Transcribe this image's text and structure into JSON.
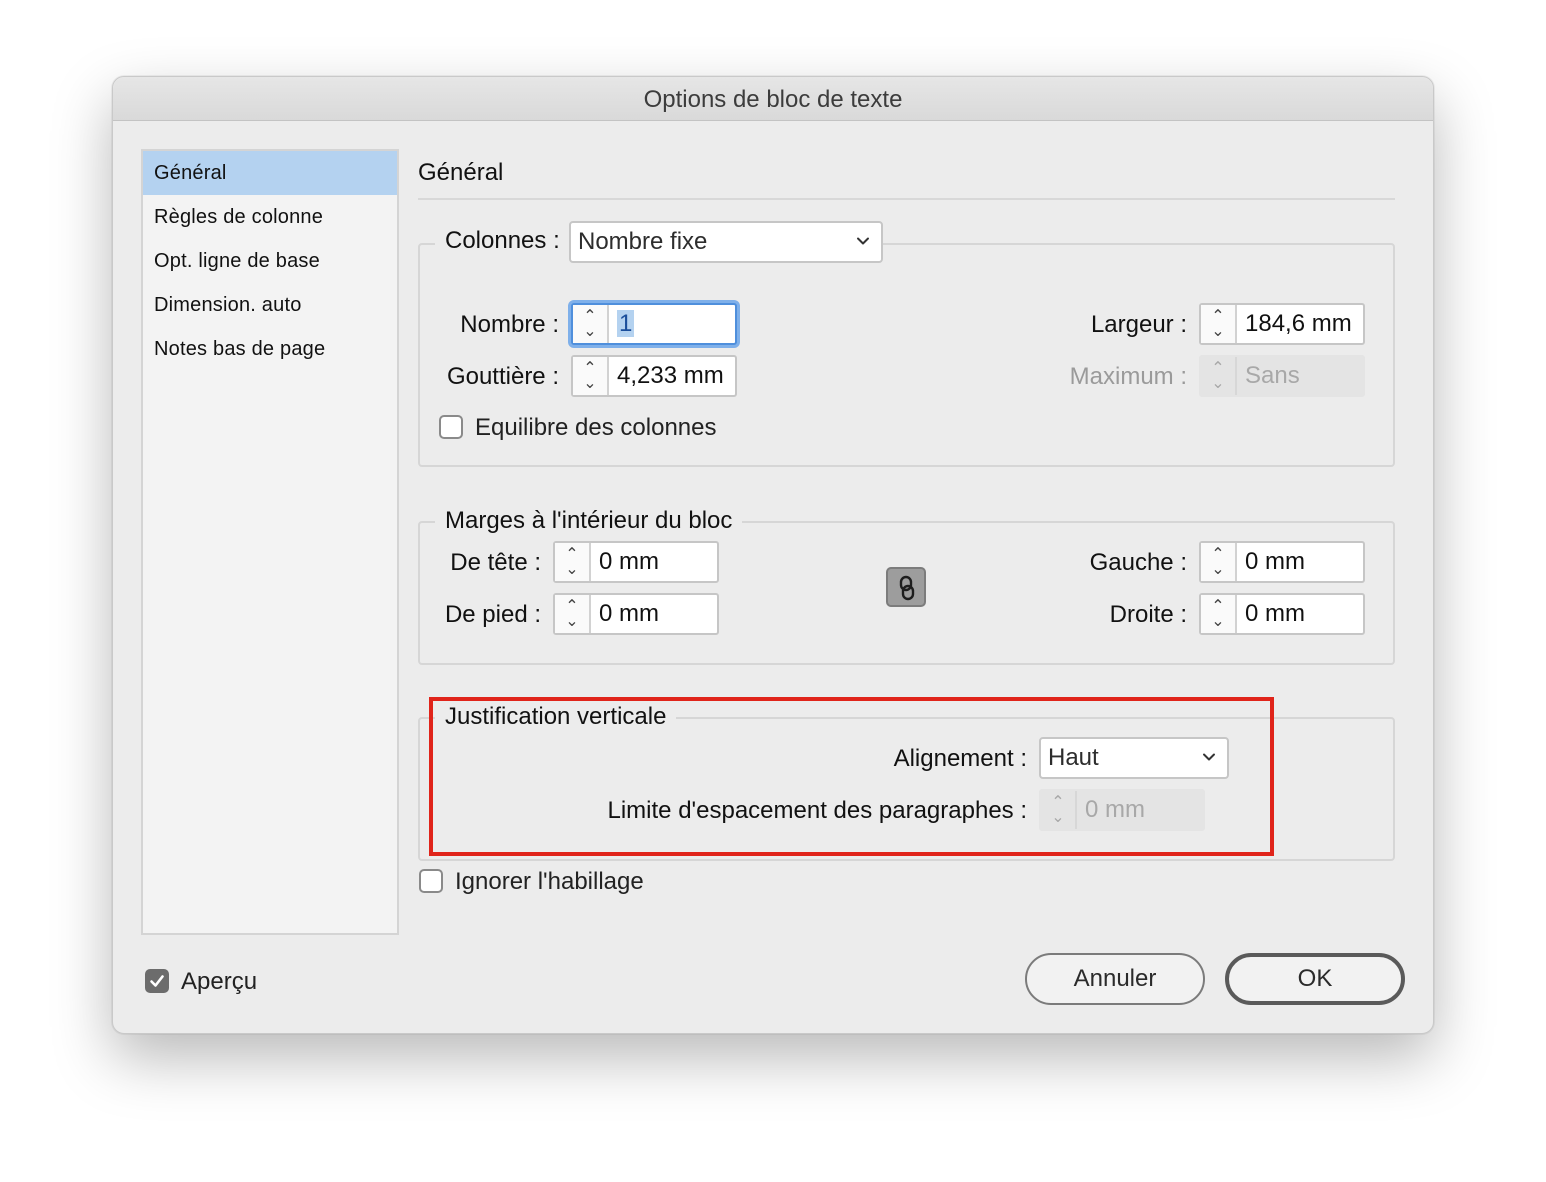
{
  "window": {
    "title": "Options de bloc de texte"
  },
  "sidebar": {
    "items": [
      {
        "label": "Général",
        "active": true
      },
      {
        "label": "Règles de colonne"
      },
      {
        "label": "Opt. ligne de base"
      },
      {
        "label": "Dimension. auto"
      },
      {
        "label": "Notes bas de page"
      }
    ]
  },
  "main": {
    "title": "Général"
  },
  "columns": {
    "legend": "Colonnes :",
    "type_value": "Nombre fixe",
    "nombre_label": "Nombre :",
    "nombre_value": "1",
    "gouttiere_label": "Gouttière :",
    "gouttiere_value": "4,233 mm",
    "largeur_label": "Largeur :",
    "largeur_value": "184,6 mm",
    "maximum_label": "Maximum :",
    "maximum_value": "Sans",
    "balance_label": "Equilibre des colonnes",
    "balance_checked": false
  },
  "margins": {
    "legend": "Marges à l'intérieur du bloc",
    "tete_label": "De tête :",
    "tete_value": "0 mm",
    "pied_label": "De pied :",
    "pied_value": "0 mm",
    "gauche_label": "Gauche :",
    "gauche_value": "0 mm",
    "droite_label": "Droite :",
    "droite_value": "0 mm",
    "link_icon": "chain-link-icon"
  },
  "vertical": {
    "legend": "Justification verticale",
    "align_label": "Alignement :",
    "align_value": "Haut",
    "limit_label": "Limite d'espacement des paragraphes :",
    "limit_value": "0 mm"
  },
  "ignore_wrap": {
    "label": "Ignorer l'habillage",
    "checked": false
  },
  "preview": {
    "label": "Aperçu",
    "checked": true
  },
  "buttons": {
    "cancel": "Annuler",
    "ok": "OK"
  },
  "colors": {
    "highlight": "#e0241a",
    "selection": "#b4d2f0",
    "focus_ring": "#7fb0ea"
  }
}
